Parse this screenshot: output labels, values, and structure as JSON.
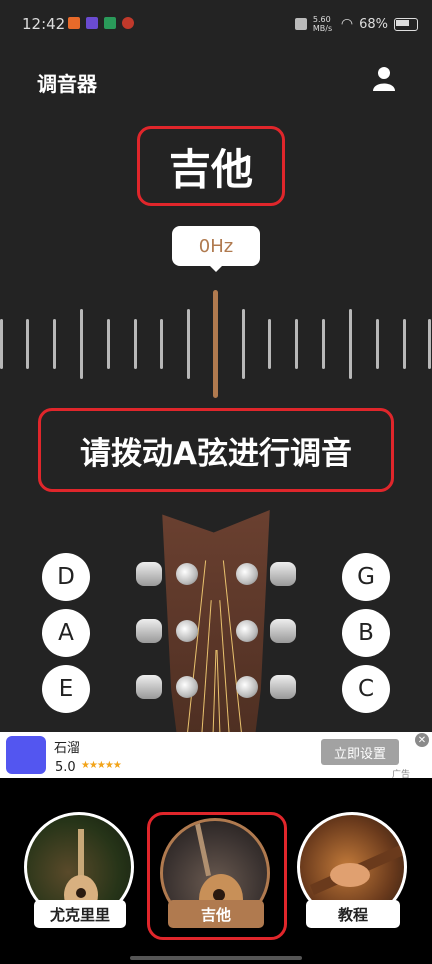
{
  "status_bar": {
    "time": "12:42",
    "net_speed": "5.60 MB/s",
    "battery": "68%"
  },
  "header": {
    "title": "调音器"
  },
  "tuner": {
    "instrument": "吉他",
    "frequency": "0Hz",
    "prompt": "请拨动A弦进行调音"
  },
  "strings": {
    "left": [
      "D",
      "A",
      "E"
    ],
    "right": [
      "G",
      "B",
      "C"
    ]
  },
  "ad": {
    "app_name": "石溜",
    "rating": "5.0",
    "stars": "★★★★★",
    "button": "立即设置",
    "tag": "广告",
    "close": "✕"
  },
  "tabs": [
    {
      "label": "尤克里里",
      "active": false
    },
    {
      "label": "吉他",
      "active": true
    },
    {
      "label": "教程",
      "active": false
    }
  ],
  "colors": {
    "accent": "#b07a4f",
    "highlight_border": "#e0262b",
    "background": "#232323"
  }
}
